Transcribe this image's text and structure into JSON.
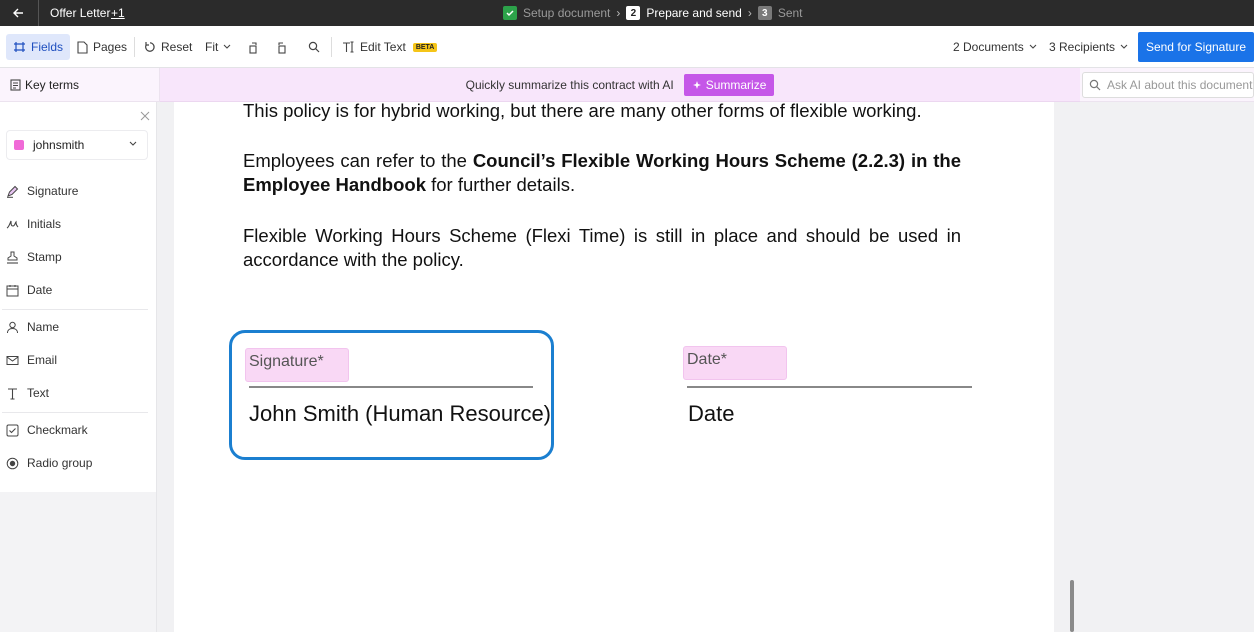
{
  "topbar": {
    "doc_title": "Offer Letter",
    "doc_extra": "+1",
    "steps": [
      {
        "label": "Setup document",
        "state": "done"
      },
      {
        "num": "2",
        "label": "Prepare and send",
        "state": "current"
      },
      {
        "num": "3",
        "label": "Sent",
        "state": "pending"
      }
    ]
  },
  "toolbar": {
    "fields": "Fields",
    "pages": "Pages",
    "reset": "Reset",
    "fit": "Fit",
    "edit_text": "Edit Text",
    "beta": "BETA",
    "documents": "2 Documents",
    "recipients": "3 Recipients",
    "send": "Send for Signature"
  },
  "banner": {
    "key_terms": "Key terms",
    "message": "Quickly summarize this contract with AI",
    "summarize": "Summarize",
    "ask_placeholder": "Ask AI about this document"
  },
  "sidebar": {
    "user": "johnsmith",
    "items": [
      {
        "label": "Signature",
        "icon": "pen-icon"
      },
      {
        "label": "Initials",
        "icon": "initials-icon"
      },
      {
        "label": "Stamp",
        "icon": "stamp-icon"
      },
      {
        "label": "Date",
        "icon": "calendar-icon"
      },
      {
        "label": "Name",
        "icon": "person-icon"
      },
      {
        "label": "Email",
        "icon": "mail-icon"
      },
      {
        "label": "Text",
        "icon": "text-icon"
      },
      {
        "label": "Checkmark",
        "icon": "checkbox-icon"
      },
      {
        "label": "Radio group",
        "icon": "radio-icon"
      }
    ]
  },
  "document": {
    "p1": "This policy is for hybrid working, but there are many other forms of flexible working.",
    "p2_a": "Employees can refer to the ",
    "p2_b": "Council’s Flexible Working Hours Scheme (2.2.3) in the Employee Handbook",
    "p2_c": " for further details.",
    "p3": "Flexible Working Hours Scheme (Flexi Time) is still in place and should be used in accordance with the policy.",
    "signature_field": "Signature*",
    "signature_name": "John Smith (Human Resource)",
    "date_field": "Date*",
    "date_label": "Date"
  },
  "colors": {
    "accent": "#1a73e8",
    "highlight_border": "#1b7fd0",
    "field_chip": "#f9d8f5",
    "summarize": "#c557e8"
  }
}
